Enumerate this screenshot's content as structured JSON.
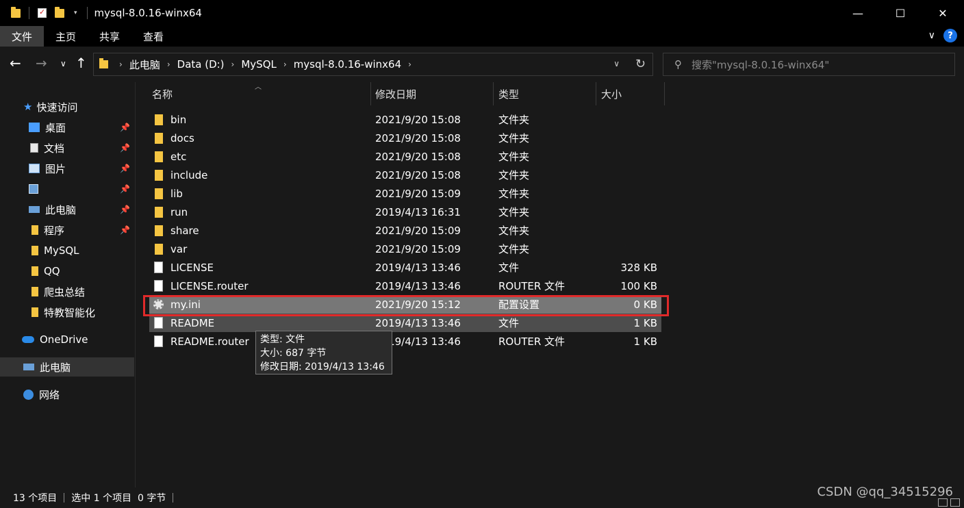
{
  "window": {
    "title": "mysql-8.0.16-winx64"
  },
  "ribbon": {
    "tabs": [
      "文件",
      "主页",
      "共享",
      "查看"
    ]
  },
  "address": {
    "crumbs": [
      "此电脑",
      "Data (D:)",
      "MySQL",
      "mysql-8.0.16-winx64"
    ],
    "search_placeholder": "搜索\"mysql-8.0.16-winx64\""
  },
  "sidebar": {
    "items": [
      {
        "label": "快速访问",
        "icon": "star-icon"
      },
      {
        "label": "桌面",
        "icon": "desktop-icon",
        "pinned": true
      },
      {
        "label": "文档",
        "icon": "document-icon",
        "pinned": true
      },
      {
        "label": "图片",
        "icon": "picture-icon",
        "pinned": true
      },
      {
        "label": "",
        "icon": "app-icon",
        "pinned": true
      },
      {
        "label": "此电脑",
        "icon": "computer-icon",
        "pinned": true
      },
      {
        "label": "程序",
        "icon": "folder-icon",
        "pinned": true
      },
      {
        "label": "MySQL",
        "icon": "folder-icon"
      },
      {
        "label": "QQ",
        "icon": "folder-icon"
      },
      {
        "label": "爬虫总结",
        "icon": "folder-icon"
      },
      {
        "label": "特教智能化",
        "icon": "folder-icon"
      },
      {
        "label": "OneDrive",
        "icon": "cloud-icon"
      },
      {
        "label": "此电脑",
        "icon": "computer-icon"
      },
      {
        "label": "网络",
        "icon": "network-icon"
      }
    ]
  },
  "columns": {
    "name": "名称",
    "date": "修改日期",
    "type": "类型",
    "size": "大小"
  },
  "files": [
    {
      "name": "bin",
      "date": "2021/9/20 15:08",
      "type": "文件夹",
      "size": "",
      "kind": "folder"
    },
    {
      "name": "docs",
      "date": "2021/9/20 15:08",
      "type": "文件夹",
      "size": "",
      "kind": "folder"
    },
    {
      "name": "etc",
      "date": "2021/9/20 15:08",
      "type": "文件夹",
      "size": "",
      "kind": "folder"
    },
    {
      "name": "include",
      "date": "2021/9/20 15:08",
      "type": "文件夹",
      "size": "",
      "kind": "folder"
    },
    {
      "name": "lib",
      "date": "2021/9/20 15:09",
      "type": "文件夹",
      "size": "",
      "kind": "folder"
    },
    {
      "name": "run",
      "date": "2019/4/13 16:31",
      "type": "文件夹",
      "size": "",
      "kind": "folder"
    },
    {
      "name": "share",
      "date": "2021/9/20 15:09",
      "type": "文件夹",
      "size": "",
      "kind": "folder"
    },
    {
      "name": "var",
      "date": "2021/9/20 15:09",
      "type": "文件夹",
      "size": "",
      "kind": "folder"
    },
    {
      "name": "LICENSE",
      "date": "2019/4/13 13:46",
      "type": "文件",
      "size": "328 KB",
      "kind": "file"
    },
    {
      "name": "LICENSE.router",
      "date": "2019/4/13 13:46",
      "type": "ROUTER 文件",
      "size": "100 KB",
      "kind": "file"
    },
    {
      "name": "my.ini",
      "date": "2021/9/20 15:12",
      "type": "配置设置",
      "size": "0 KB",
      "kind": "config"
    },
    {
      "name": "README",
      "date": "2019/4/13 13:46",
      "type": "文件",
      "size": "1 KB",
      "kind": "file"
    },
    {
      "name": "README.router",
      "date": "2019/4/13 13:46",
      "type": "ROUTER 文件",
      "size": "1 KB",
      "kind": "file"
    }
  ],
  "tooltip": {
    "line1": "类型: 文件",
    "line2": "大小: 687 字节",
    "line3": "修改日期: 2019/4/13 13:46"
  },
  "status": {
    "count": "13 个项目",
    "selection": "选中 1 个项目  0 字节"
  },
  "watermark": "CSDN @qq_34515296"
}
